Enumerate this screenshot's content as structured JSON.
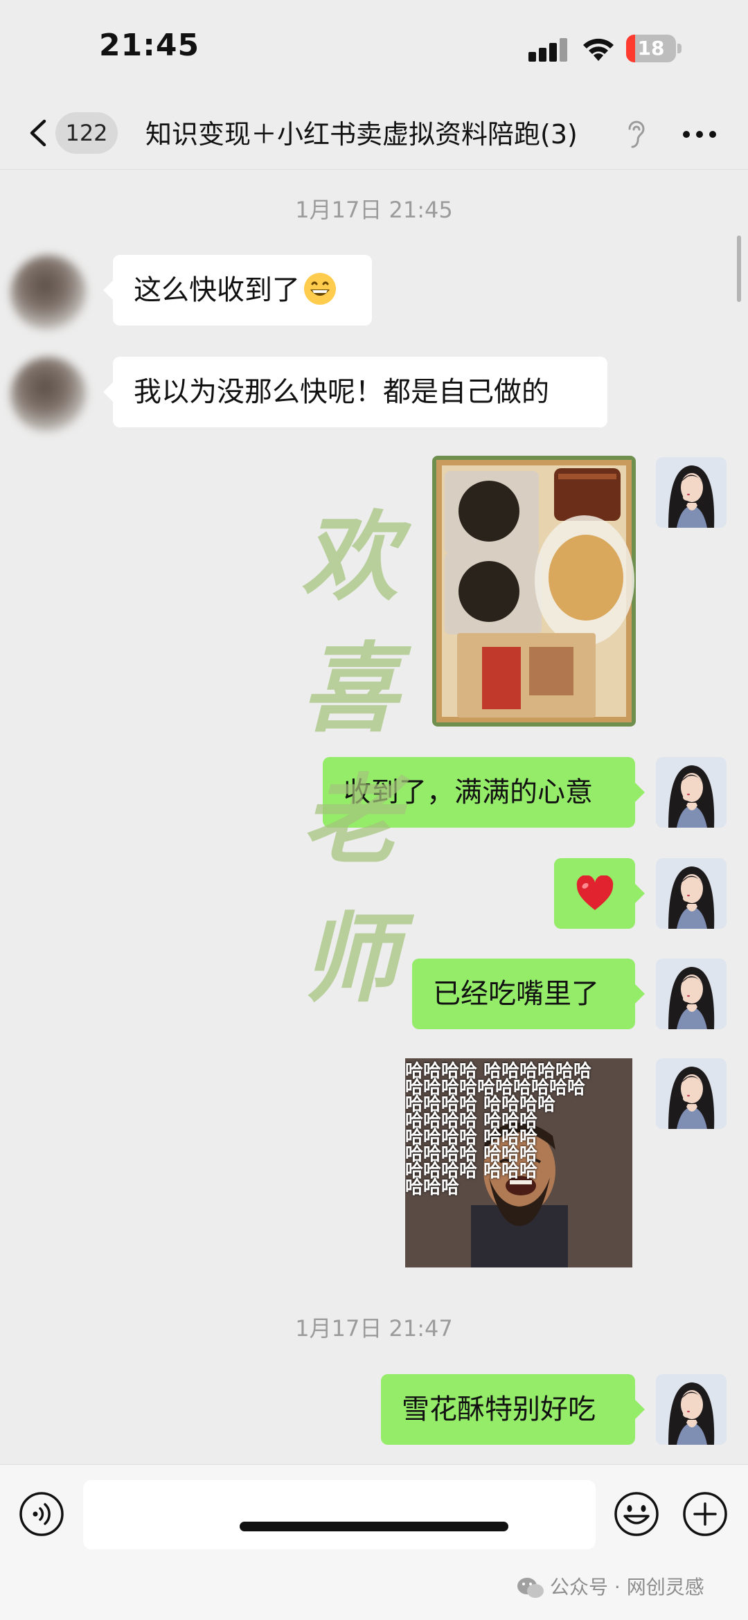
{
  "status_bar": {
    "time": "21:45",
    "battery": "18",
    "battery_fraction": 0.18,
    "icons": [
      "signal-icon",
      "wifi-icon",
      "battery-icon"
    ]
  },
  "nav": {
    "unread_count": "122",
    "title": "知识变现＋小红书卖虚拟资料陪跑",
    "member_count": "(3)",
    "icons": [
      "back-chevron-icon",
      "ear-icon",
      "more-icon"
    ]
  },
  "messages": {
    "timestamp_1": "1月17日 21:45",
    "in_1": "这么快收到了",
    "in_2": "我以为没那么快呢！都是自己做的",
    "out_1": "收到了，满满的心意",
    "out_3": "已经吃嘴里了",
    "sticker_lines": [
      "哈哈哈哈 哈哈哈哈哈哈",
      "哈哈哈哈哈哈哈哈哈哈",
      "哈哈哈哈      哈哈哈哈",
      "哈哈哈哈          哈哈哈",
      "哈哈哈哈          哈哈哈",
      "哈哈哈哈          哈哈哈",
      "哈哈哈哈          哈哈哈",
      "                      哈哈哈"
    ],
    "timestamp_2": "1月17日 21:47",
    "out_5": "雪花酥特别好吃"
  },
  "watermark": {
    "chars": [
      "欢",
      "喜",
      "老",
      "师"
    ],
    "color": "#a4c47c"
  },
  "input_bar": {
    "placeholder": "",
    "icons": [
      "voice-icon",
      "emoji-icon",
      "plus-icon"
    ]
  },
  "footer": {
    "wechat_mark": "公众号 · 网创灵感"
  },
  "colors": {
    "chat_bg": "#ededed",
    "outgoing_bubble": "#95ec69",
    "incoming_bubble": "#ffffff",
    "battery_low": "#ff3b30"
  }
}
